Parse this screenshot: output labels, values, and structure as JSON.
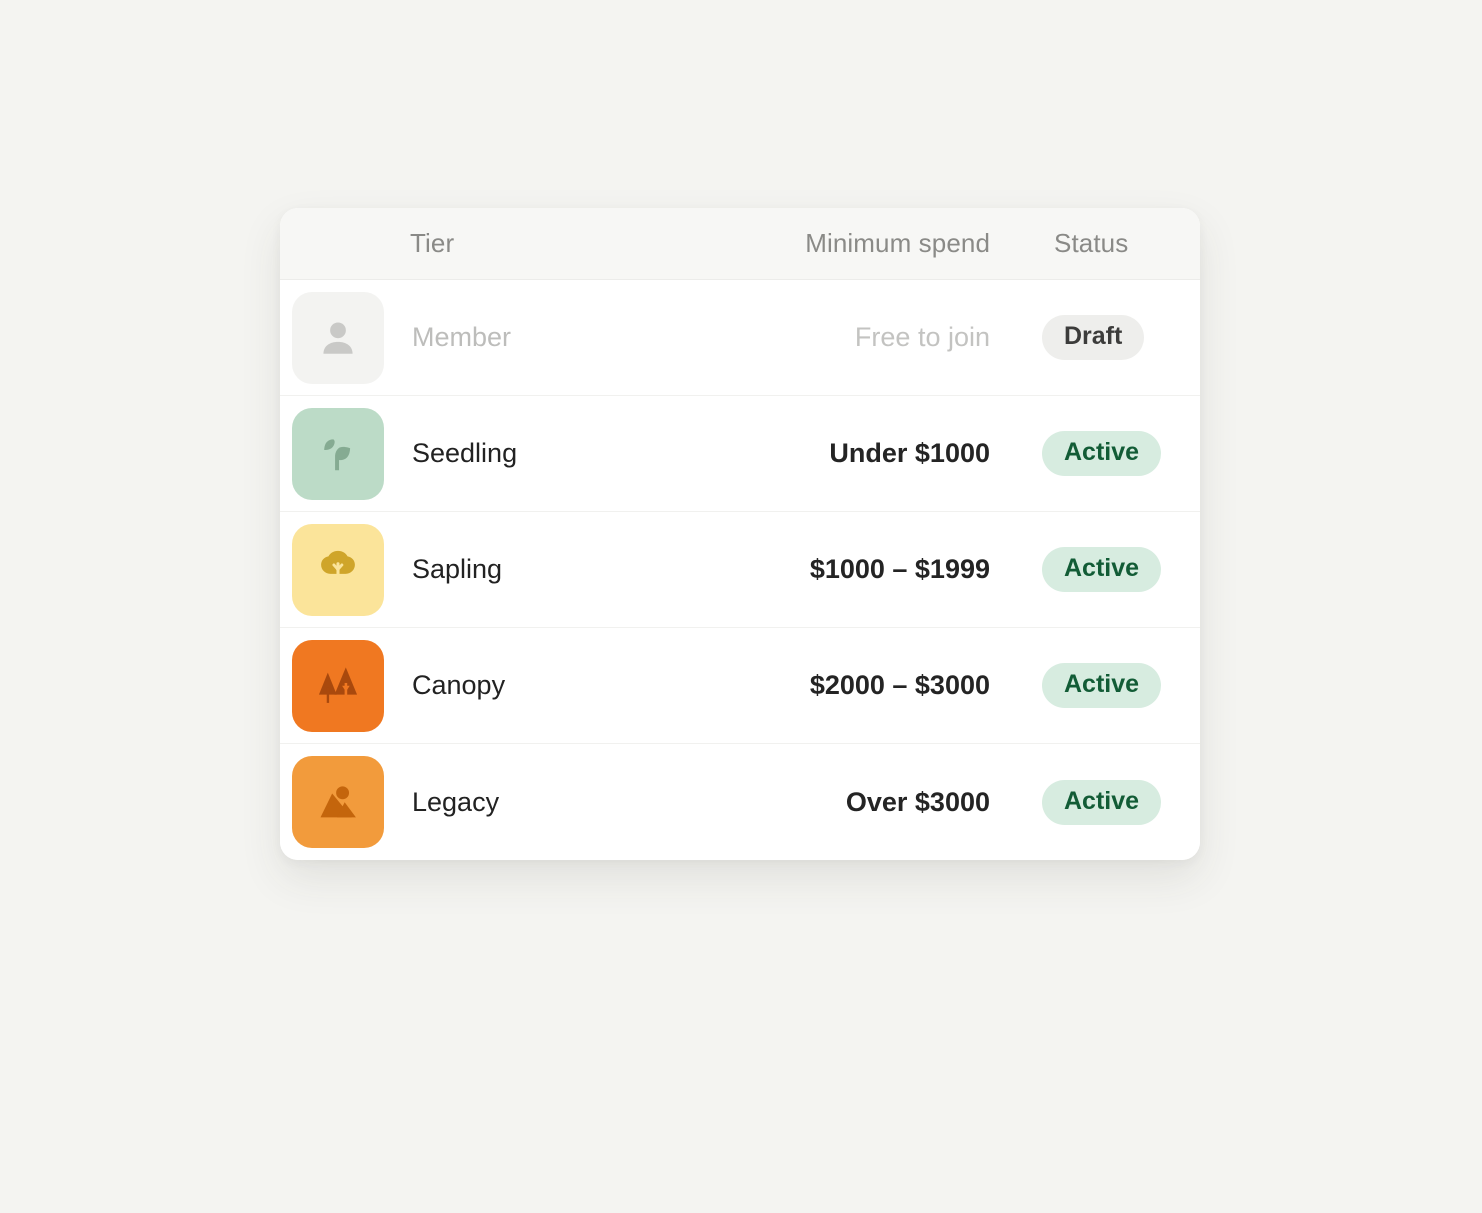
{
  "table": {
    "columns": [
      {
        "key": "tier",
        "label": "Tier"
      },
      {
        "key": "spend",
        "label": "Minimum spend"
      },
      {
        "key": "status",
        "label": "Status"
      }
    ],
    "rows": [
      {
        "tier": "Member",
        "spend": "Free to join",
        "status": "Draft",
        "status_kind": "draft",
        "icon": "person-avatar-icon",
        "icon_bg": "#f3f3f1",
        "icon_fg": "#c9c9c7",
        "muted": true
      },
      {
        "tier": "Seedling",
        "spend": "Under $1000",
        "status": "Active",
        "status_kind": "active",
        "icon": "sprout-icon",
        "icon_bg": "#bcdbc7",
        "icon_fg": "#85ab92",
        "muted": false
      },
      {
        "tier": "Sapling",
        "spend": "$1000 – $1999",
        "status": "Active",
        "status_kind": "active",
        "icon": "tree-icon",
        "icon_bg": "#fbe49a",
        "icon_fg": "#cfa52a",
        "muted": false
      },
      {
        "tier": "Canopy",
        "spend": "$2000 – $3000",
        "status": "Active",
        "status_kind": "active",
        "icon": "pine-trees-icon",
        "icon_bg": "#f07821",
        "icon_fg": "#a9490d",
        "muted": false
      },
      {
        "tier": "Legacy",
        "spend": "Over $3000",
        "status": "Active",
        "status_kind": "active",
        "icon": "mountain-icon",
        "icon_bg": "#f29b3c",
        "icon_fg": "#c4650c",
        "muted": false
      }
    ]
  },
  "colors": {
    "page_background": "#f4f4f1",
    "card_background": "#ffffff",
    "header_background": "#f7f7f5",
    "header_text": "#8a8a87",
    "row_text": "#222222",
    "muted_text": "#bdbdbb",
    "badge_draft_bg": "#eeeeec",
    "badge_draft_text": "#3c3c3b",
    "badge_active_bg": "#d7ece0",
    "badge_active_text": "#125c36",
    "divider": "#f1f1ef"
  }
}
